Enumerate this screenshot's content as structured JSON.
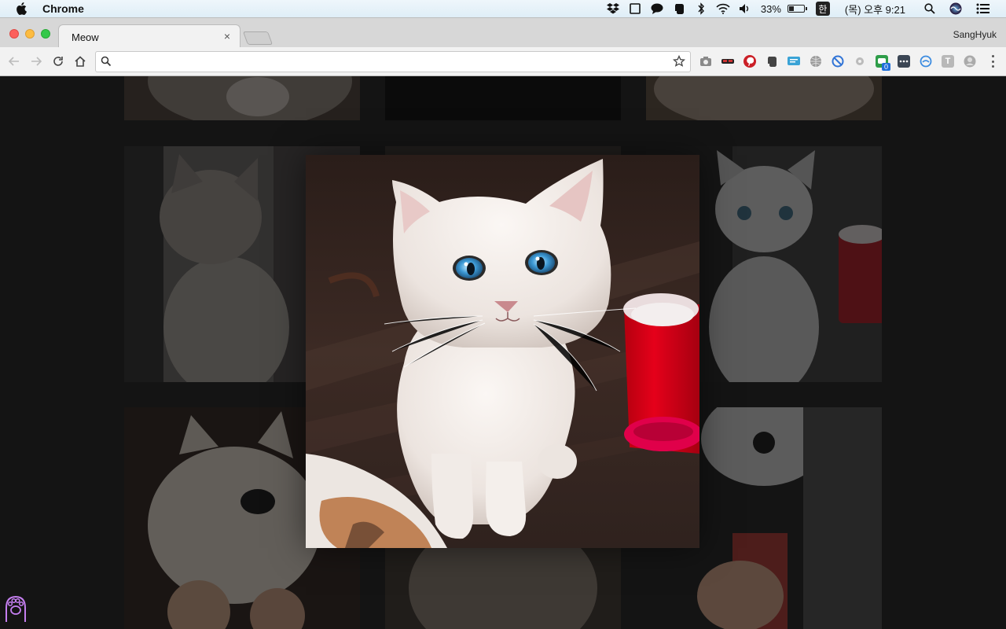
{
  "menubar": {
    "app_name": "Chrome",
    "battery": "33%",
    "ime": "한",
    "clock": "(목) 오후 9:21",
    "icons": [
      "apple-icon",
      "dropbox-icon",
      "frame-icon",
      "messages-icon",
      "evernote-icon",
      "bluetooth-icon",
      "wifi-icon",
      "volume-icon",
      "battery-icon",
      "ime-icon",
      "spotlight-icon",
      "siri-icon",
      "notification-center-icon"
    ]
  },
  "browser": {
    "tab_title": "Meow",
    "tab_close": "×",
    "profile_name": "SangHyuk",
    "omnibox_value": "",
    "extensions": [
      "camera-icon",
      "spy-icon",
      "pinterest-icon",
      "evernote-icon",
      "translate-icon",
      "globe-icon",
      "block-icon",
      "gear-icon",
      "chat-icon",
      "dots-icon",
      "refresh-icon",
      "t-icon",
      "avatar-icon"
    ],
    "extension_badge": "0"
  },
  "page": {
    "gallery_tiles": 9,
    "lightbox_subject": "white cat with blue eyes",
    "paw_logo": "paw-icon",
    "accent": "#c57ff0"
  }
}
